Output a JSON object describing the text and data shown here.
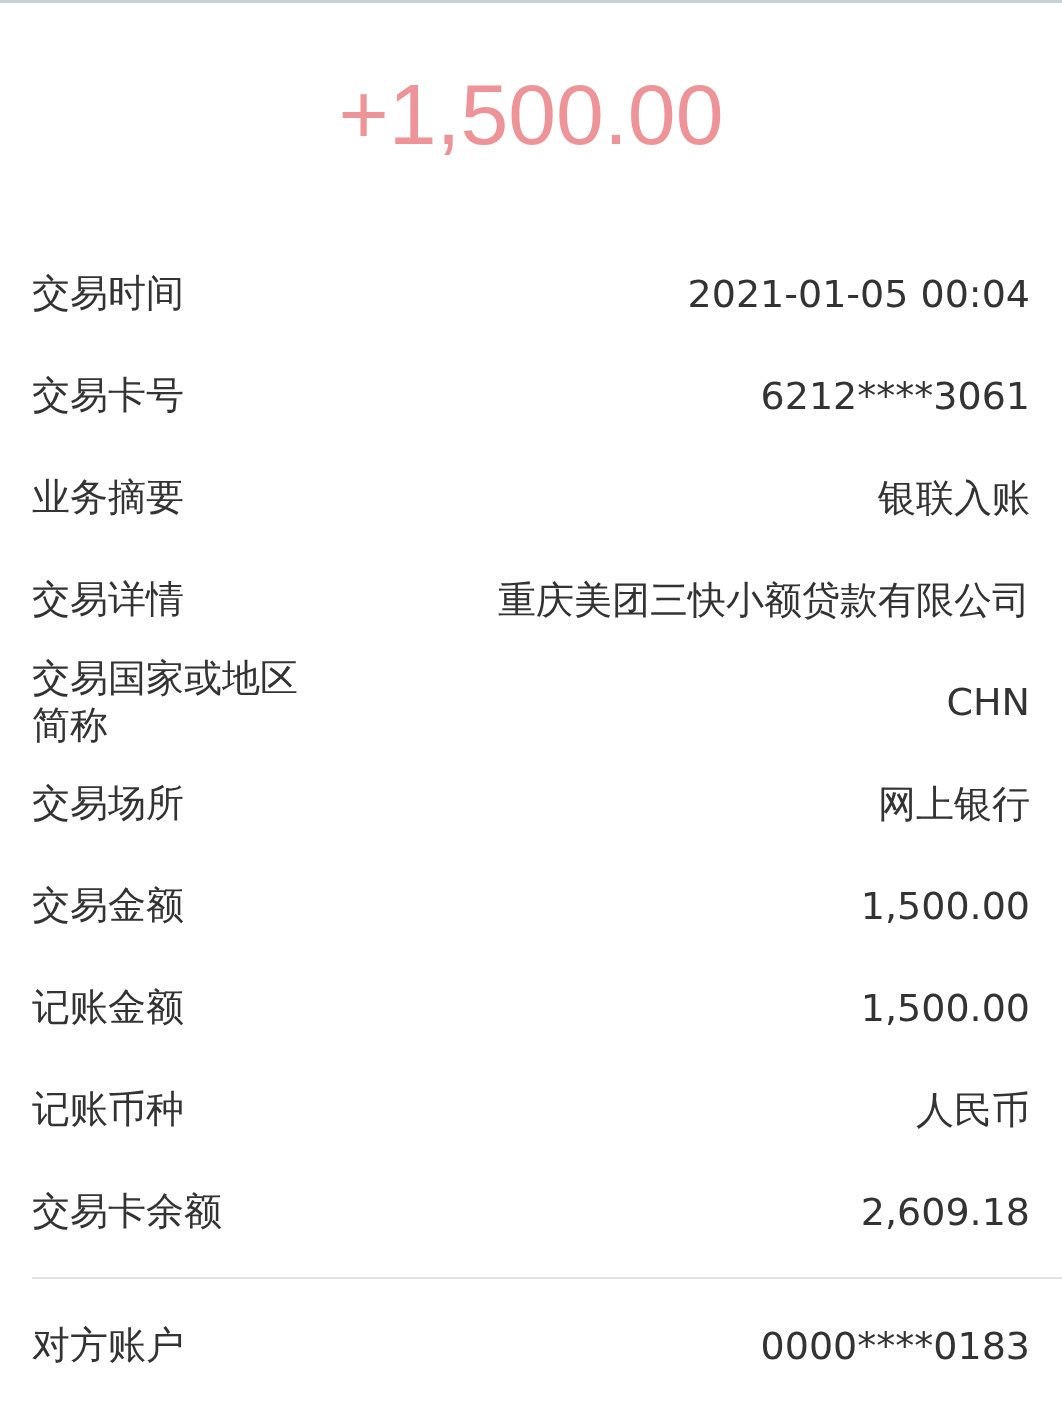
{
  "amount": "+1,500.00",
  "details": [
    {
      "label": "交易时间",
      "value": "2021-01-05 00:04"
    },
    {
      "label": "交易卡号",
      "value": "6212****3061"
    },
    {
      "label": "业务摘要",
      "value": "银联入账"
    },
    {
      "label": "交易详情",
      "value": "重庆美团三快小额贷款有限公司"
    },
    {
      "label": "交易国家或地区简称",
      "value": "CHN"
    },
    {
      "label": "交易场所",
      "value": "网上银行"
    },
    {
      "label": "交易金额",
      "value": "1,500.00"
    },
    {
      "label": "记账金额",
      "value": "1,500.00"
    },
    {
      "label": "记账币种",
      "value": "人民币"
    },
    {
      "label": "交易卡余额",
      "value": "2,609.18"
    }
  ],
  "counterparty": [
    {
      "label": "对方账户",
      "value": "0000****0183"
    }
  ]
}
